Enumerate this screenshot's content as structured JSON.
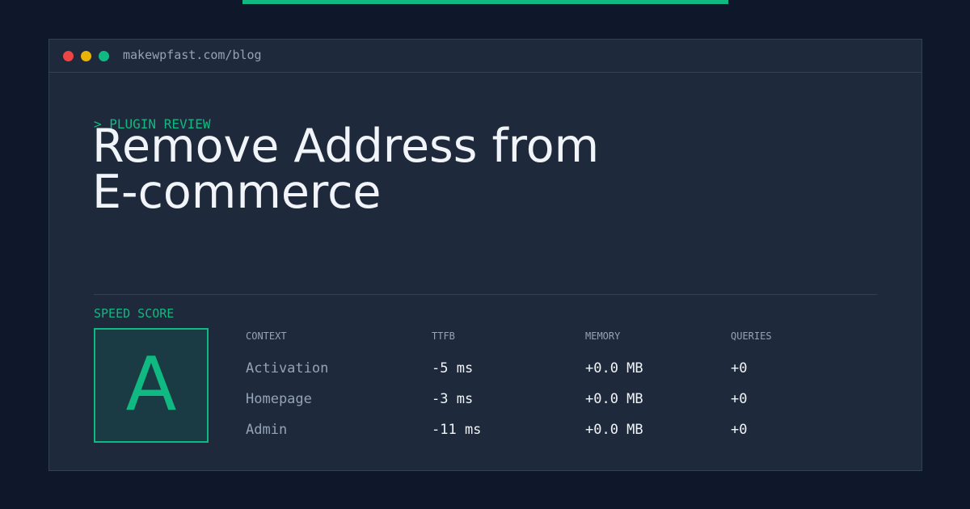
{
  "url": "makewpfast.com/blog",
  "kicker": "> PLUGIN REVIEW",
  "title_lines": [
    "Remove Address from",
    "E-commerce"
  ],
  "speed_score": {
    "label": "SPEED SCORE",
    "grade": "A"
  },
  "table": {
    "headers": {
      "context": "CONTEXT",
      "ttfb": "TTFB",
      "memory": "MEMORY",
      "queries": "QUERIES"
    },
    "rows": [
      {
        "context": "Activation",
        "ttfb": "-5 ms",
        "memory": "+0.0 MB",
        "queries": "+0"
      },
      {
        "context": "Homepage",
        "ttfb": "-3 ms",
        "memory": "+0.0 MB",
        "queries": "+0"
      },
      {
        "context": "Admin",
        "ttfb": "-11 ms",
        "memory": "+0.0 MB",
        "queries": "+0"
      }
    ]
  },
  "colors": {
    "background": "#0f172a",
    "card": "#1e293b",
    "accent": "#10b981",
    "text": "#f1f5f9",
    "muted": "#94a3b8"
  }
}
